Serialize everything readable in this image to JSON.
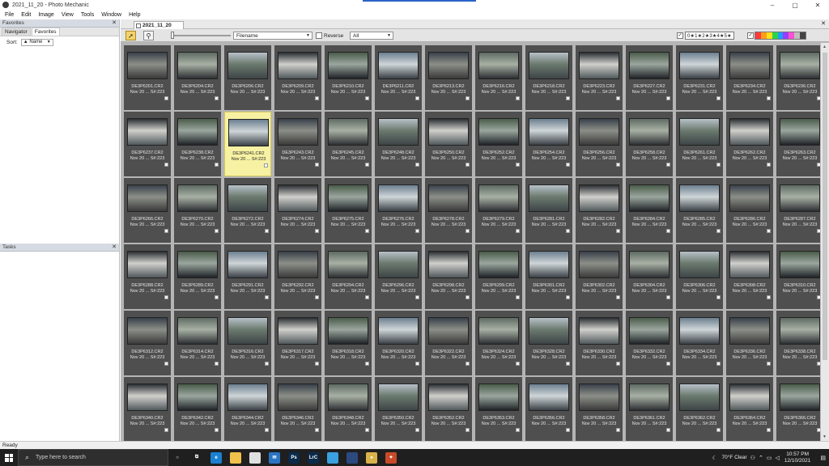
{
  "window": {
    "title": "2021_11_20 - Photo Mechanic",
    "minimize": "–",
    "maximize": "▢",
    "close": "✕"
  },
  "menu": [
    "File",
    "Edit",
    "Image",
    "View",
    "Tools",
    "Window",
    "Help"
  ],
  "favorites_panel": {
    "title": "Favorites",
    "close": "✕",
    "tabs": [
      "Navigator",
      "Favorites"
    ],
    "sort_label": "Sort:",
    "sort_value": "▲ Name"
  },
  "tasks_panel": {
    "title": "Tasks",
    "close": "✕"
  },
  "contact_sheet": {
    "tab_title": "2021_11_20",
    "tab_close": "✕",
    "window_close": "✕",
    "sort_dropdown": "Filename",
    "reverse_label": "Reverse",
    "filter_dropdown": "All",
    "rating_filter": "0★1★2★3★4★5★",
    "check": "✓"
  },
  "colors": {
    "selected_cell": "#f7f1a3",
    "cell_bg": "#4f4f4f",
    "label_colors": [
      "#ff3a3a",
      "#ff9d1a",
      "#ffe11a",
      "#2bd44a",
      "#1e9cff",
      "#9b3cff",
      "#ff4fd2",
      "#bfbfbf",
      "#444444"
    ]
  },
  "thumbnails": [
    {
      "name": "DE3P6201.CR2",
      "date": "Nov 20 ... S#:223"
    },
    {
      "name": "DE3P6204.CR2",
      "date": "Nov 20 ... S#:223"
    },
    {
      "name": "DE3P6206.CR2",
      "date": "Nov 20 ... S#:223"
    },
    {
      "name": "DE3P6209.CR2",
      "date": "Nov 20 ... S#:223"
    },
    {
      "name": "DE3P6210.CR2",
      "date": "Nov 20 ... S#:223"
    },
    {
      "name": "DE3P6211.CR2",
      "date": "Nov 20 ... S#:223"
    },
    {
      "name": "DE3P6213.CR2",
      "date": "Nov 20 ... S#:223"
    },
    {
      "name": "DE3P6216.CR2",
      "date": "Nov 20 ... S#:223"
    },
    {
      "name": "DE3P6218.CR2",
      "date": "Nov 20 ... S#:223"
    },
    {
      "name": "DE3P6223.CR2",
      "date": "Nov 20 ... S#:223"
    },
    {
      "name": "DE3P6227.CR2",
      "date": "Nov 20 ... S#:223"
    },
    {
      "name": "DE3P6231.CR2",
      "date": "Nov 20 ... S#:223"
    },
    {
      "name": "DE3P6234.CR2",
      "date": "Nov 20 ... S#:223"
    },
    {
      "name": "DE3P6236.CR2",
      "date": "Nov 20 ... S#:223"
    },
    {
      "name": "DE3P6237.CR2",
      "date": "Nov 20 ... S#:223"
    },
    {
      "name": "DE3P6238.CR2",
      "date": "Nov 20 ... S#:223"
    },
    {
      "name": "DE3P6241.CR2",
      "date": "Nov 20 ... S#:223",
      "selected": true
    },
    {
      "name": "DE3P6243.CR2",
      "date": "Nov 20 ... S#:223"
    },
    {
      "name": "DE3P6245.CR2",
      "date": "Nov 20 ... S#:223"
    },
    {
      "name": "DE3P6248.CR2",
      "date": "Nov 20 ... S#:223"
    },
    {
      "name": "DE3P6250.CR2",
      "date": "Nov 20 ... S#:223"
    },
    {
      "name": "DE3P6252.CR2",
      "date": "Nov 20 ... S#:223"
    },
    {
      "name": "DE3P6254.CR2",
      "date": "Nov 20 ... S#:223"
    },
    {
      "name": "DE3P6256.CR2",
      "date": "Nov 20 ... S#:223"
    },
    {
      "name": "DE3P6258.CR2",
      "date": "Nov 20 ... S#:223"
    },
    {
      "name": "DE3P6261.CR2",
      "date": "Nov 20 ... S#:223"
    },
    {
      "name": "DE3P6262.CR2",
      "date": "Nov 20 ... S#:223"
    },
    {
      "name": "DE3P6263.CR2",
      "date": "Nov 20 ... S#:223"
    },
    {
      "name": "DE3P6266.CR2",
      "date": "Nov 20 ... S#:223"
    },
    {
      "name": "DE3P6270.CR2",
      "date": "Nov 20 ... S#:223"
    },
    {
      "name": "DE3P6272.CR2",
      "date": "Nov 20 ... S#:223"
    },
    {
      "name": "DE3P6274.CR2",
      "date": "Nov 20 ... S#:223"
    },
    {
      "name": "DE3P6275.CR2",
      "date": "Nov 20 ... S#:223"
    },
    {
      "name": "DE3P6276.CR2",
      "date": "Nov 20 ... S#:223"
    },
    {
      "name": "DE3P6278.CR2",
      "date": "Nov 20 ... S#:223"
    },
    {
      "name": "DE3P6279.CR2",
      "date": "Nov 20 ... S#:223"
    },
    {
      "name": "DE3P6281.CR2",
      "date": "Nov 20 ... S#:223"
    },
    {
      "name": "DE3P6282.CR2",
      "date": "Nov 20 ... S#:223"
    },
    {
      "name": "DE3P6284.CR2",
      "date": "Nov 20 ... S#:223"
    },
    {
      "name": "DE3P6285.CR2",
      "date": "Nov 20 ... S#:223"
    },
    {
      "name": "DE3P6286.CR2",
      "date": "Nov 20 ... S#:223"
    },
    {
      "name": "DE3P6287.CR2",
      "date": "Nov 20 ... S#:223"
    },
    {
      "name": "DE3P6288.CR2",
      "date": "Nov 20 ... S#:223"
    },
    {
      "name": "DE3P6289.CR2",
      "date": "Nov 20 ... S#:223"
    },
    {
      "name": "DE3P6291.CR2",
      "date": "Nov 20 ... S#:223"
    },
    {
      "name": "DE3P6292.CR2",
      "date": "Nov 20 ... S#:223"
    },
    {
      "name": "DE3P6294.CR2",
      "date": "Nov 20 ... S#:223"
    },
    {
      "name": "DE3P6296.CR2",
      "date": "Nov 20 ... S#:223"
    },
    {
      "name": "DE3P6298.CR2",
      "date": "Nov 20 ... S#:223"
    },
    {
      "name": "DE3P6299.CR2",
      "date": "Nov 20 ... S#:223"
    },
    {
      "name": "DE3P6301.CR2",
      "date": "Nov 20 ... S#:223"
    },
    {
      "name": "DE3P6302.CR2",
      "date": "Nov 20 ... S#:223"
    },
    {
      "name": "DE3P6304.CR2",
      "date": "Nov 20 ... S#:223"
    },
    {
      "name": "DE3P6306.CR2",
      "date": "Nov 20 ... S#:223"
    },
    {
      "name": "DE3P6308.CR2",
      "date": "Nov 20 ... S#:223"
    },
    {
      "name": "DE3P6310.CR2",
      "date": "Nov 20 ... S#:223"
    },
    {
      "name": "DE3P6312.CR2",
      "date": "Nov 20 ... S#:223"
    },
    {
      "name": "DE3P6314.CR2",
      "date": "Nov 20 ... S#:223"
    },
    {
      "name": "DE3P6316.CR2",
      "date": "Nov 20 ... S#:223"
    },
    {
      "name": "DE3P6317.CR2",
      "date": "Nov 20 ... S#:223"
    },
    {
      "name": "DE3P6318.CR2",
      "date": "Nov 20 ... S#:223"
    },
    {
      "name": "DE3P6320.CR2",
      "date": "Nov 20 ... S#:223"
    },
    {
      "name": "DE3P6322.CR2",
      "date": "Nov 20 ... S#:223"
    },
    {
      "name": "DE3P6324.CR2",
      "date": "Nov 20 ... S#:223"
    },
    {
      "name": "DE3P6328.CR2",
      "date": "Nov 20 ... S#:223"
    },
    {
      "name": "DE3P6330.CR2",
      "date": "Nov 20 ... S#:223"
    },
    {
      "name": "DE3P6332.CR2",
      "date": "Nov 20 ... S#:223"
    },
    {
      "name": "DE3P6334.CR2",
      "date": "Nov 20 ... S#:223"
    },
    {
      "name": "DE3P6336.CR2",
      "date": "Nov 20 ... S#:223"
    },
    {
      "name": "DE3P6338.CR2",
      "date": "Nov 20 ... S#:223"
    },
    {
      "name": "DE3P6340.CR2",
      "date": "Nov 20 ... S#:223"
    },
    {
      "name": "DE3P6342.CR2",
      "date": "Nov 20 ... S#:223"
    },
    {
      "name": "DE3P6344.CR2",
      "date": "Nov 20 ... S#:223"
    },
    {
      "name": "DE3P6346.CR2",
      "date": "Nov 20 ... S#:223"
    },
    {
      "name": "DE3P6348.CR2",
      "date": "Nov 20 ... S#:223"
    },
    {
      "name": "DE3P6350.CR2",
      "date": "Nov 20 ... S#:223"
    },
    {
      "name": "DE3P6352.CR2",
      "date": "Nov 20 ... S#:223"
    },
    {
      "name": "DE3P6353.CR2",
      "date": "Nov 20 ... S#:223"
    },
    {
      "name": "DE3P6356.CR2",
      "date": "Nov 20 ... S#:223"
    },
    {
      "name": "DE3P6358.CR2",
      "date": "Nov 20 ... S#:223"
    },
    {
      "name": "DE3P6361.CR2",
      "date": "Nov 20 ... S#:223"
    },
    {
      "name": "DE3P6362.CR2",
      "date": "Nov 20 ... S#:223"
    },
    {
      "name": "DE3P6364.CR2",
      "date": "Nov 20 ... S#:223"
    },
    {
      "name": "DE3P6366.CR2",
      "date": "Nov 20 ... S#:223"
    }
  ],
  "statusbar": {
    "text": "Ready"
  },
  "taskbar": {
    "search_placeholder": "Type here to search",
    "apps": [
      {
        "icon": "cortana-icon",
        "color": "#1f1f1f",
        "label": "○"
      },
      {
        "icon": "task-view-icon",
        "color": "#1f1f1f",
        "label": "⧉"
      },
      {
        "icon": "edge-icon",
        "color": "#1a7fd1",
        "label": "e"
      },
      {
        "icon": "file-explorer-icon",
        "color": "#f2c14b",
        "label": ""
      },
      {
        "icon": "calendar-icon",
        "color": "#e0e0e0",
        "label": ""
      },
      {
        "icon": "mail-icon",
        "color": "#2a74c4",
        "label": "✉"
      },
      {
        "icon": "photoshop-icon",
        "color": "#0a2a4a",
        "label": "Ps"
      },
      {
        "icon": "lightroom-classic-icon",
        "color": "#0a2a4a",
        "label": "LrC"
      },
      {
        "icon": "photos-icon",
        "color": "#3aa0e0",
        "label": ""
      },
      {
        "icon": "photo-app-icon",
        "color": "#2c4a80",
        "label": ""
      },
      {
        "icon": "round-app-icon",
        "color": "#d9b34a",
        "label": "●"
      },
      {
        "icon": "photo-mechanic-icon",
        "color": "#c84a2a",
        "label": "✦"
      }
    ],
    "weather_icon": "moon-icon",
    "weather": "70°F  Clear",
    "time": "10:57 PM",
    "date": "12/10/2021"
  }
}
